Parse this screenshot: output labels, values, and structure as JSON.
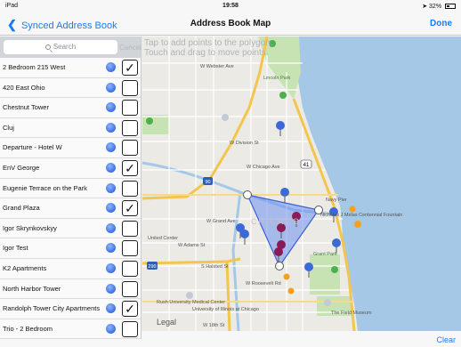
{
  "status": {
    "device": "iPad",
    "time": "19:58",
    "battery": "32%"
  },
  "nav": {
    "back_label": "Synced Address Book",
    "title": "Address Book Map",
    "done_label": "Done"
  },
  "map": {
    "hint_line1": "Tap to add points to the polygon.",
    "hint_line2": "Touch and drag to move points.",
    "legal": "Legal",
    "labels": {
      "lincoln_park": "Lincoln Park",
      "w_webster": "W Webster Ave",
      "w_division": "W Division St",
      "w_chicago": "W Chicago Ave",
      "w_grand": "W Grand Ave",
      "w_adams": "W Adams St",
      "w_roosevelt": "W Roosevelt Rd",
      "s_halsted": "S Halsted St",
      "navy_pier": "Navy Pier",
      "chicago": "CHICAGO",
      "rush": "Rush University Medical Center",
      "uic": "University of Illinois at Chicago",
      "grant_park": "Grant Park",
      "field_museum": "The Field Museum",
      "united_center": "United Center",
      "nicholas": "Nicholas J Melas Centennial Fountain",
      "w_18th": "W 18th St",
      "route_41": "41",
      "route_90": "90",
      "route_290": "290"
    }
  },
  "sidebar": {
    "search_placeholder": "Search",
    "cancel_label": "Cancel",
    "items": [
      {
        "name": "2 Bedroom 215 West",
        "checked": true
      },
      {
        "name": "420 East Ohio",
        "checked": false
      },
      {
        "name": "Chestnut Tower",
        "checked": false
      },
      {
        "name": "Cluj",
        "checked": false
      },
      {
        "name": "Departure - Hotel W",
        "checked": false
      },
      {
        "name": "EnV George",
        "checked": true
      },
      {
        "name": "Eugenie Terrace on the Park",
        "checked": false
      },
      {
        "name": "Grand Plaza",
        "checked": true
      },
      {
        "name": "Igor Skrynkovskyy",
        "checked": false
      },
      {
        "name": "Igor Test",
        "checked": false
      },
      {
        "name": "K2 Apartments",
        "checked": false
      },
      {
        "name": "North Harbor Tower",
        "checked": false
      },
      {
        "name": "Randolph Tower City Apartments",
        "checked": true
      },
      {
        "name": "Trio - 2 Bedroom",
        "checked": false
      }
    ],
    "check_mark": "✓"
  },
  "bottom": {
    "clear_label": "Clear"
  }
}
